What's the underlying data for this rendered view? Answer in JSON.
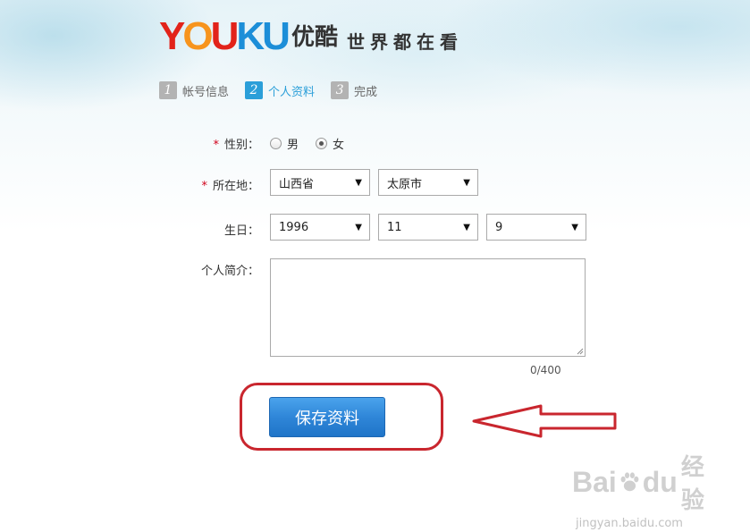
{
  "brand": {
    "logo_letters": [
      {
        "ch": "Y",
        "color": "#e2231a"
      },
      {
        "ch": "O",
        "color": "#f7941d"
      },
      {
        "ch": "U",
        "color": "#e2231a"
      },
      {
        "ch": "K",
        "color": "#1c8ed8"
      },
      {
        "ch": "U",
        "color": "#1c8ed8"
      }
    ],
    "logo_cn": "优酷",
    "slogan": "世界都在看"
  },
  "steps": [
    {
      "num": "1",
      "label": "帐号信息",
      "active": false,
      "color": "#b3b3b3"
    },
    {
      "num": "2",
      "label": "个人资料",
      "active": true,
      "color": "#2b9fd9"
    },
    {
      "num": "3",
      "label": "完成",
      "active": false,
      "color": "#b3b3b3"
    }
  ],
  "form": {
    "required_mark": "*",
    "gender": {
      "label": "性别：",
      "options": [
        {
          "label": "男",
          "selected": false
        },
        {
          "label": "女",
          "selected": true
        }
      ]
    },
    "location": {
      "label": "所在地：",
      "province": "山西省",
      "city": "太原市"
    },
    "birthday": {
      "label": "生日：",
      "year": "1996",
      "month": "11",
      "day": "9"
    },
    "bio": {
      "label": "个人简介：",
      "value": "",
      "counter": "0/400"
    },
    "save_label": "保存资料"
  },
  "dropdown_caret": "▼",
  "colors": {
    "required": "#d0021b",
    "button": "#2f86d8",
    "annotation": "#c9262e"
  },
  "watermark": {
    "left": "Bai",
    "right": "du",
    "cn": "经验",
    "url": "jingyan.baidu.com"
  }
}
